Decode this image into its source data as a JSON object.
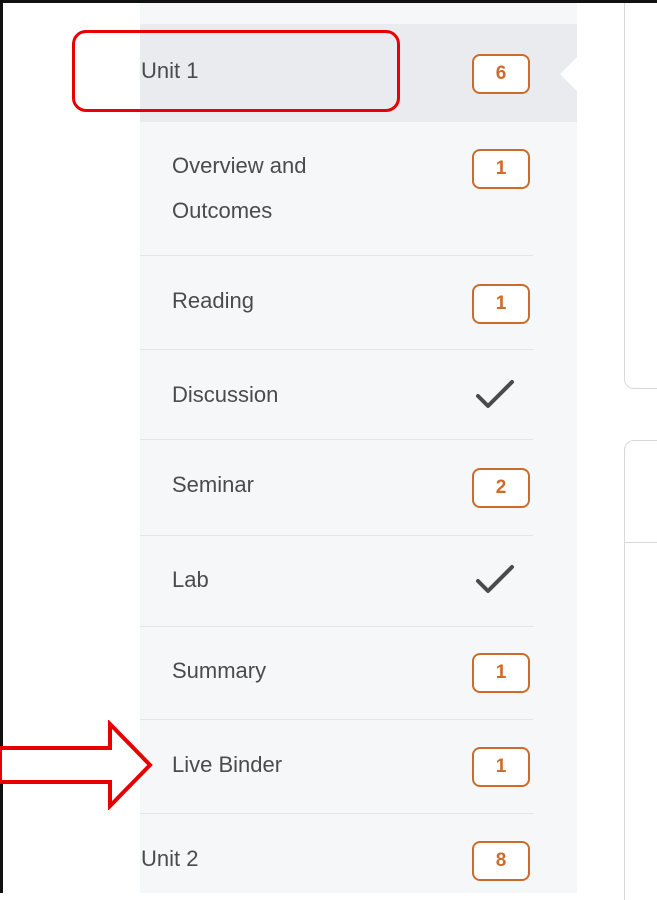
{
  "units": [
    {
      "label": "Unit 1",
      "badge": "6"
    },
    {
      "label": "Unit 2",
      "badge": "8"
    }
  ],
  "unit1_items": [
    {
      "label_line1": "Overview and",
      "label_line2": "Outcomes",
      "badge": "1"
    },
    {
      "label": "Reading",
      "badge": "1"
    },
    {
      "label": "Discussion",
      "status": "check-icon"
    },
    {
      "label": "Seminar",
      "badge": "2"
    },
    {
      "label": "Lab",
      "status": "check-icon"
    },
    {
      "label": "Summary",
      "badge": "1"
    },
    {
      "label": "Live Binder",
      "badge": "1"
    }
  ],
  "colors": {
    "badge": "#cd6b2b",
    "annotation": "#e60000",
    "sidebar_bg": "#f6f7f8",
    "selected_bg": "#e9ebee",
    "text": "#494c4e"
  }
}
